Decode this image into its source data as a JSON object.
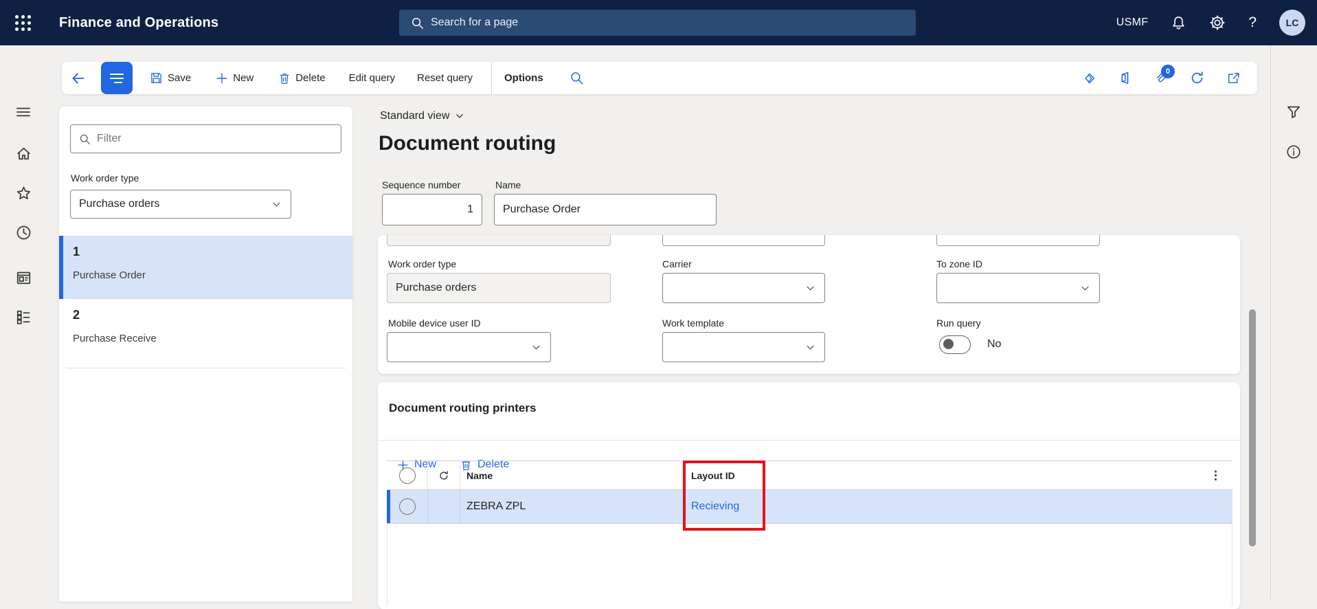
{
  "topbar": {
    "app_title": "Finance and Operations",
    "search_placeholder": "Search for a page",
    "company": "USMF",
    "help_glyph": "?",
    "avatar_initials": "LC"
  },
  "command_bar": {
    "save_label": "Save",
    "new_label": "New",
    "delete_label": "Delete",
    "edit_query_label": "Edit query",
    "reset_query_label": "Reset query",
    "options_label": "Options",
    "attachments_count": "0"
  },
  "left_panel": {
    "filter_placeholder": "Filter",
    "work_order_type_label": "Work order type",
    "work_order_type_value": "Purchase orders",
    "items": [
      {
        "number": "1",
        "name": "Purchase Order",
        "selected": true
      },
      {
        "number": "2",
        "name": "Purchase Receive",
        "selected": false
      }
    ]
  },
  "page": {
    "view_selector": "Standard view",
    "title": "Document routing",
    "sequence_number_label": "Sequence number",
    "sequence_number_value": "1",
    "name_label": "Name",
    "name_value": "Purchase Order"
  },
  "details": {
    "work_order_type_label": "Work order type",
    "work_order_type_value": "Purchase orders",
    "carrier_label": "Carrier",
    "to_zone_label": "To zone ID",
    "mobile_device_user_label": "Mobile device user ID",
    "work_template_label": "Work template",
    "run_query_label": "Run query",
    "run_query_value": "No"
  },
  "printers": {
    "section_title": "Document routing printers",
    "new_label": "New",
    "delete_label": "Delete",
    "kebab_glyph": "⋮",
    "columns": {
      "name": "Name",
      "layout_id": "Layout ID"
    },
    "rows": [
      {
        "name": "ZEBRA ZPL",
        "layout_id": "Recieving"
      }
    ]
  },
  "colors": {
    "header_bg": "#0e2142",
    "accent_blue": "#2266e3",
    "selected_row_bg": "#d7e3f8",
    "highlight_red": "#e3131b",
    "page_bg": "#f1f0ee"
  }
}
